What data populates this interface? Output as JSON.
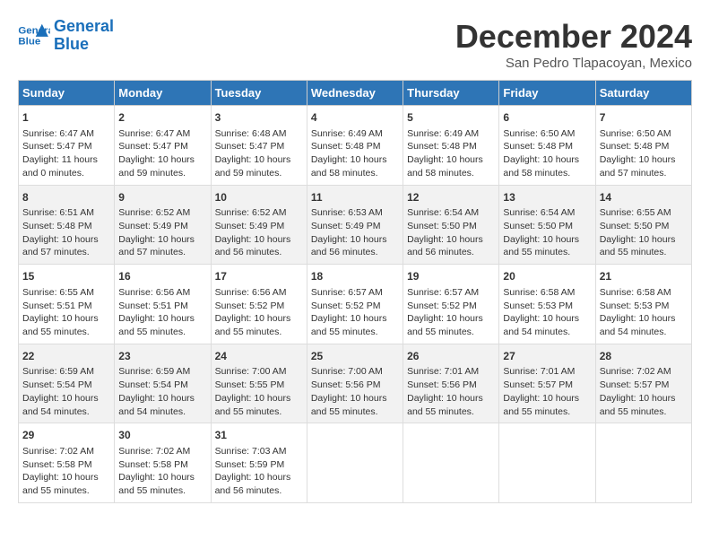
{
  "logo": {
    "line1": "General",
    "line2": "Blue"
  },
  "title": "December 2024",
  "subtitle": "San Pedro Tlapacoyan, Mexico",
  "weekdays": [
    "Sunday",
    "Monday",
    "Tuesday",
    "Wednesday",
    "Thursday",
    "Friday",
    "Saturday"
  ],
  "weeks": [
    [
      {
        "day": "1",
        "info": "Sunrise: 6:47 AM\nSunset: 5:47 PM\nDaylight: 11 hours\nand 0 minutes."
      },
      {
        "day": "2",
        "info": "Sunrise: 6:47 AM\nSunset: 5:47 PM\nDaylight: 10 hours\nand 59 minutes."
      },
      {
        "day": "3",
        "info": "Sunrise: 6:48 AM\nSunset: 5:47 PM\nDaylight: 10 hours\nand 59 minutes."
      },
      {
        "day": "4",
        "info": "Sunrise: 6:49 AM\nSunset: 5:48 PM\nDaylight: 10 hours\nand 58 minutes."
      },
      {
        "day": "5",
        "info": "Sunrise: 6:49 AM\nSunset: 5:48 PM\nDaylight: 10 hours\nand 58 minutes."
      },
      {
        "day": "6",
        "info": "Sunrise: 6:50 AM\nSunset: 5:48 PM\nDaylight: 10 hours\nand 58 minutes."
      },
      {
        "day": "7",
        "info": "Sunrise: 6:50 AM\nSunset: 5:48 PM\nDaylight: 10 hours\nand 57 minutes."
      }
    ],
    [
      {
        "day": "8",
        "info": "Sunrise: 6:51 AM\nSunset: 5:48 PM\nDaylight: 10 hours\nand 57 minutes."
      },
      {
        "day": "9",
        "info": "Sunrise: 6:52 AM\nSunset: 5:49 PM\nDaylight: 10 hours\nand 57 minutes."
      },
      {
        "day": "10",
        "info": "Sunrise: 6:52 AM\nSunset: 5:49 PM\nDaylight: 10 hours\nand 56 minutes."
      },
      {
        "day": "11",
        "info": "Sunrise: 6:53 AM\nSunset: 5:49 PM\nDaylight: 10 hours\nand 56 minutes."
      },
      {
        "day": "12",
        "info": "Sunrise: 6:54 AM\nSunset: 5:50 PM\nDaylight: 10 hours\nand 56 minutes."
      },
      {
        "day": "13",
        "info": "Sunrise: 6:54 AM\nSunset: 5:50 PM\nDaylight: 10 hours\nand 55 minutes."
      },
      {
        "day": "14",
        "info": "Sunrise: 6:55 AM\nSunset: 5:50 PM\nDaylight: 10 hours\nand 55 minutes."
      }
    ],
    [
      {
        "day": "15",
        "info": "Sunrise: 6:55 AM\nSunset: 5:51 PM\nDaylight: 10 hours\nand 55 minutes."
      },
      {
        "day": "16",
        "info": "Sunrise: 6:56 AM\nSunset: 5:51 PM\nDaylight: 10 hours\nand 55 minutes."
      },
      {
        "day": "17",
        "info": "Sunrise: 6:56 AM\nSunset: 5:52 PM\nDaylight: 10 hours\nand 55 minutes."
      },
      {
        "day": "18",
        "info": "Sunrise: 6:57 AM\nSunset: 5:52 PM\nDaylight: 10 hours\nand 55 minutes."
      },
      {
        "day": "19",
        "info": "Sunrise: 6:57 AM\nSunset: 5:52 PM\nDaylight: 10 hours\nand 55 minutes."
      },
      {
        "day": "20",
        "info": "Sunrise: 6:58 AM\nSunset: 5:53 PM\nDaylight: 10 hours\nand 54 minutes."
      },
      {
        "day": "21",
        "info": "Sunrise: 6:58 AM\nSunset: 5:53 PM\nDaylight: 10 hours\nand 54 minutes."
      }
    ],
    [
      {
        "day": "22",
        "info": "Sunrise: 6:59 AM\nSunset: 5:54 PM\nDaylight: 10 hours\nand 54 minutes."
      },
      {
        "day": "23",
        "info": "Sunrise: 6:59 AM\nSunset: 5:54 PM\nDaylight: 10 hours\nand 54 minutes."
      },
      {
        "day": "24",
        "info": "Sunrise: 7:00 AM\nSunset: 5:55 PM\nDaylight: 10 hours\nand 55 minutes."
      },
      {
        "day": "25",
        "info": "Sunrise: 7:00 AM\nSunset: 5:56 PM\nDaylight: 10 hours\nand 55 minutes."
      },
      {
        "day": "26",
        "info": "Sunrise: 7:01 AM\nSunset: 5:56 PM\nDaylight: 10 hours\nand 55 minutes."
      },
      {
        "day": "27",
        "info": "Sunrise: 7:01 AM\nSunset: 5:57 PM\nDaylight: 10 hours\nand 55 minutes."
      },
      {
        "day": "28",
        "info": "Sunrise: 7:02 AM\nSunset: 5:57 PM\nDaylight: 10 hours\nand 55 minutes."
      }
    ],
    [
      {
        "day": "29",
        "info": "Sunrise: 7:02 AM\nSunset: 5:58 PM\nDaylight: 10 hours\nand 55 minutes."
      },
      {
        "day": "30",
        "info": "Sunrise: 7:02 AM\nSunset: 5:58 PM\nDaylight: 10 hours\nand 55 minutes."
      },
      {
        "day": "31",
        "info": "Sunrise: 7:03 AM\nSunset: 5:59 PM\nDaylight: 10 hours\nand 56 minutes."
      },
      {
        "day": "",
        "info": ""
      },
      {
        "day": "",
        "info": ""
      },
      {
        "day": "",
        "info": ""
      },
      {
        "day": "",
        "info": ""
      }
    ]
  ]
}
